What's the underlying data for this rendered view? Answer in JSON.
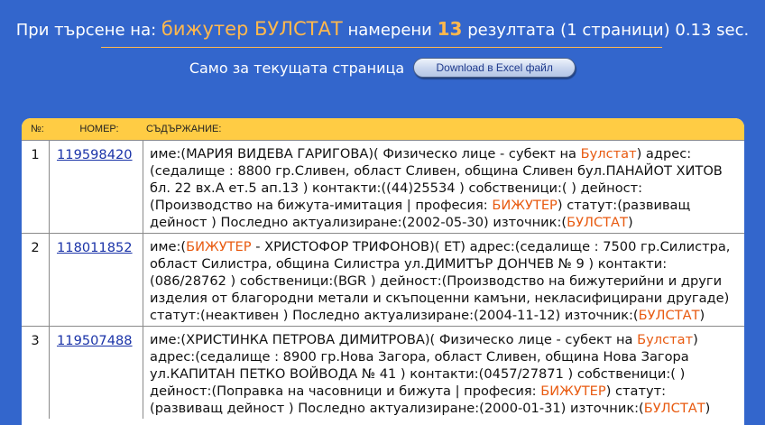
{
  "summary": {
    "prefix": "При търсене на:",
    "query": "бижутер БУЛСТАТ",
    "found_label": "намерени",
    "count": "13",
    "suffix": "резултата (1 страници) 0.13 sec."
  },
  "page_only_label": "Само за текущата страница",
  "excel_button": "Download в Excel файл",
  "table_header": {
    "no": "№:",
    "number": "НОМЕР:",
    "content": "СЪДЪРЖАНИЕ:"
  },
  "results": [
    {
      "no": "1",
      "id": "119598420",
      "parts": [
        {
          "t": "име:(МАРИЯ ВИДЕВА ГАРИГОВА)( Физическо лице - субект на "
        },
        {
          "t": "Булстат",
          "hl": true
        },
        {
          "t": ") адрес:(седалище : 8800 гр.Сливен, област Сливен, община Сливен бул.ПАНАЙОТ ХИТОВ бл. 22 вх.А ет.5 ап.13 ) контакти:((44)25534 ) собственици:( ) дейност:(Производство на бижута-имитация | професия: "
        },
        {
          "t": "БИЖУТЕР",
          "hl": true
        },
        {
          "t": ") статут:(развиващ дейност ) Последно актуализиране:(2002-05-30) източник:("
        },
        {
          "t": "БУЛСТАТ",
          "hl": true
        },
        {
          "t": ")"
        }
      ]
    },
    {
      "no": "2",
      "id": "118011852",
      "parts": [
        {
          "t": "име:("
        },
        {
          "t": "БИЖУТЕР",
          "hl": true
        },
        {
          "t": " - ХРИСТОФОР ТРИФОНОВ)( ЕТ) адрес:(седалище : 7500 гр.Силистра, област Силистра, община Силистра ул.ДИМИТЪР ДОНЧЕВ № 9 ) контакти:(086/28762 ) собственици:(BGR ) дейност:(Производство на бижутерийни и други изделия от благородни метали и скъпоценни камъни, некласифицирани другаде) статут:(неактивен ) Последно актуализиране:(2004-11-12) източник:("
        },
        {
          "t": "БУЛСТАТ",
          "hl": true
        },
        {
          "t": ")"
        }
      ]
    },
    {
      "no": "3",
      "id": "119507488",
      "parts": [
        {
          "t": "име:(ХРИСТИНКА ПЕТРОВА ДИМИТРОВА)( Физическо лице - субект на "
        },
        {
          "t": "Булстат",
          "hl": true
        },
        {
          "t": ") адрес:(седалище : 8900 гр.Нова Загора, област Сливен, община Нова Загора ул.КАПИТАН ПЕТКО ВОЙВОДА № 41 ) контакти:(0457/27871 ) собственици:( ) дейност:(Поправка на часовници и бижута | професия: "
        },
        {
          "t": "БИЖУТЕР",
          "hl": true
        },
        {
          "t": ") статут:(развиващ дейност ) Последно актуализиране:(2000-01-31) източник:("
        },
        {
          "t": "БУЛСТАТ",
          "hl": true
        },
        {
          "t": ")"
        }
      ]
    }
  ],
  "colors": {
    "background": "#3366cc",
    "accent": "#ffb84d",
    "header_bar": "#ffcc44",
    "highlight": "#e85a10",
    "link": "#1a33a8"
  }
}
